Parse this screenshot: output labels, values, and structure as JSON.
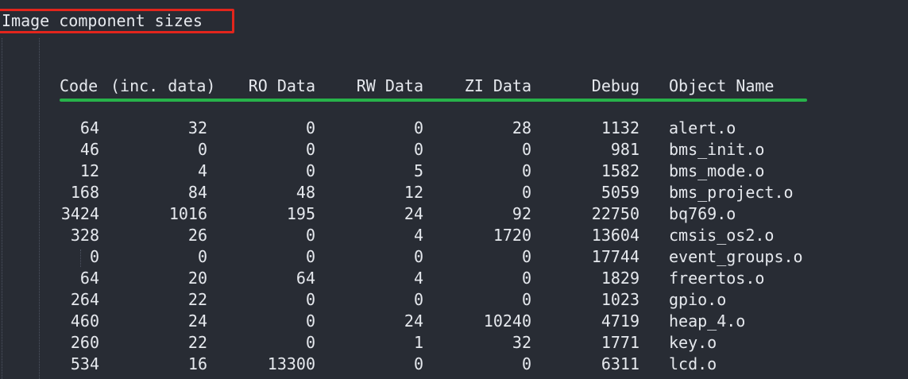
{
  "title": "Image component sizes",
  "colors": {
    "background": "#282c34",
    "text": "#e6e9ee",
    "title_highlight_box": "#e2251c",
    "header_underline": "#27b34a"
  },
  "headers": {
    "code": "Code",
    "inc_data": "(inc. data)",
    "ro_data": "RO Data",
    "rw_data": "RW Data",
    "zi_data": "ZI Data",
    "debug": "Debug",
    "object_name": "Object Name"
  },
  "rows": [
    {
      "code": "64",
      "inc_data": "32",
      "ro_data": "0",
      "rw_data": "0",
      "zi_data": "28",
      "debug": "1132",
      "object_name": "alert.o"
    },
    {
      "code": "46",
      "inc_data": "0",
      "ro_data": "0",
      "rw_data": "0",
      "zi_data": "0",
      "debug": "981",
      "object_name": "bms_init.o"
    },
    {
      "code": "12",
      "inc_data": "4",
      "ro_data": "0",
      "rw_data": "5",
      "zi_data": "0",
      "debug": "1582",
      "object_name": "bms_mode.o"
    },
    {
      "code": "168",
      "inc_data": "84",
      "ro_data": "48",
      "rw_data": "12",
      "zi_data": "0",
      "debug": "5059",
      "object_name": "bms_project.o"
    },
    {
      "code": "3424",
      "inc_data": "1016",
      "ro_data": "195",
      "rw_data": "24",
      "zi_data": "92",
      "debug": "22750",
      "object_name": "bq769.o"
    },
    {
      "code": "328",
      "inc_data": "26",
      "ro_data": "0",
      "rw_data": "4",
      "zi_data": "1720",
      "debug": "13604",
      "object_name": "cmsis_os2.o"
    },
    {
      "code": "0",
      "inc_data": "0",
      "ro_data": "0",
      "rw_data": "0",
      "zi_data": "0",
      "debug": "17744",
      "object_name": "event_groups.o"
    },
    {
      "code": "64",
      "inc_data": "20",
      "ro_data": "64",
      "rw_data": "4",
      "zi_data": "0",
      "debug": "1829",
      "object_name": "freertos.o"
    },
    {
      "code": "264",
      "inc_data": "22",
      "ro_data": "0",
      "rw_data": "0",
      "zi_data": "0",
      "debug": "1023",
      "object_name": "gpio.o"
    },
    {
      "code": "460",
      "inc_data": "24",
      "ro_data": "0",
      "rw_data": "24",
      "zi_data": "10240",
      "debug": "4719",
      "object_name": "heap_4.o"
    },
    {
      "code": "260",
      "inc_data": "22",
      "ro_data": "0",
      "rw_data": "1",
      "zi_data": "32",
      "debug": "1771",
      "object_name": "key.o"
    },
    {
      "code": "534",
      "inc_data": "16",
      "ro_data": "13300",
      "rw_data": "0",
      "zi_data": "0",
      "debug": "6311",
      "object_name": "lcd.o"
    }
  ]
}
